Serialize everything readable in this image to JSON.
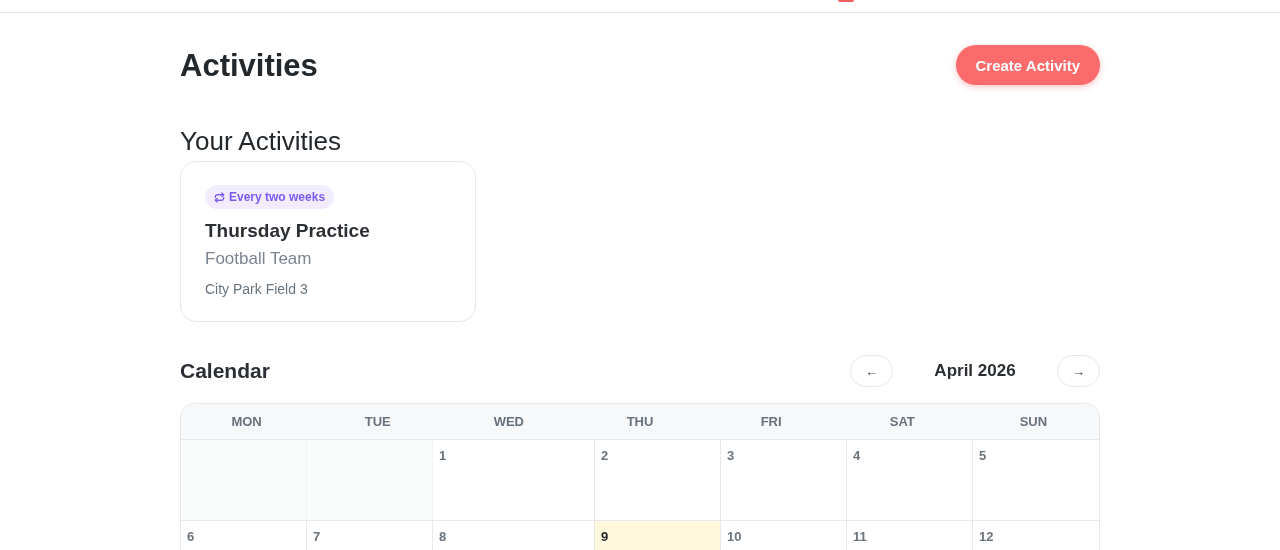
{
  "page": {
    "title": "Activities",
    "create_button": "Create Activity"
  },
  "your_activities": {
    "heading": "Your Activities",
    "cards": [
      {
        "recurrence": "Every two weeks",
        "title": "Thursday Practice",
        "team": "Football Team",
        "location": "City Park Field 3"
      }
    ]
  },
  "calendar": {
    "heading": "Calendar",
    "prev": "←",
    "month": "April 2026",
    "next": "→",
    "weekdays": [
      "MON",
      "TUE",
      "WED",
      "THU",
      "FRI",
      "SAT",
      "SUN"
    ],
    "weeks": [
      [
        {
          "kind": "blank"
        },
        {
          "kind": "blank"
        },
        {
          "kind": "day",
          "day": "1",
          "today": false
        },
        {
          "kind": "day",
          "day": "2",
          "today": false
        },
        {
          "kind": "day",
          "day": "3",
          "today": false
        },
        {
          "kind": "day",
          "day": "4",
          "today": false
        },
        {
          "kind": "day",
          "day": "5",
          "today": false
        }
      ],
      [
        {
          "kind": "day",
          "day": "6",
          "today": false
        },
        {
          "kind": "day",
          "day": "7",
          "today": false
        },
        {
          "kind": "day",
          "day": "8",
          "today": false
        },
        {
          "kind": "day",
          "day": "9",
          "today": true
        },
        {
          "kind": "day",
          "day": "10",
          "today": false
        },
        {
          "kind": "day",
          "day": "11",
          "today": false
        },
        {
          "kind": "day",
          "day": "12",
          "today": false
        }
      ]
    ]
  }
}
